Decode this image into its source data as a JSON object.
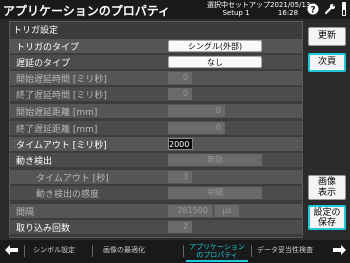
{
  "window": {
    "title": "アプリケーションのプロパティ",
    "setup_line1": "選択中セットアップ",
    "setup_line2": "Setup 1",
    "date": "2021/05/13",
    "time": "16:28"
  },
  "panel": {
    "title": "トリガ設定",
    "rows": {
      "trigger_type": {
        "label": "トリガのタイプ",
        "value": "シングル(外部)"
      },
      "delay_type": {
        "label": "遅延のタイプ",
        "value": "なし"
      },
      "start_delay_time": {
        "label": "開始遅延時間 [ミリ秒]",
        "value": "0"
      },
      "end_delay_time": {
        "label": "終了遅延時間 [ミリ秒]",
        "value": "0"
      },
      "start_delay_distance": {
        "label": "開始遅延距離 [mm]",
        "value": "0"
      },
      "end_delay_distance": {
        "label": "終了遅延距離 [mm]",
        "value": "0"
      },
      "timeout": {
        "label": "タイムアウト [ミリ秒]",
        "value": "2000"
      },
      "motion_detection": {
        "label": "動き検出",
        "value": "無効"
      },
      "motion_timeout": {
        "label": "タイムアウト [秒]",
        "value": "3"
      },
      "motion_sensitivity": {
        "label": "動き検出の感度",
        "value": "中間"
      },
      "interval": {
        "label": "間隔",
        "value": "281500",
        "unit": "μs"
      },
      "capture_count": {
        "label": "取り込み回数",
        "value": "2"
      }
    }
  },
  "side_buttons": {
    "update": "更新",
    "next": "次頁",
    "image_display_l1": "画像",
    "image_display_l2": "表示",
    "save_settings_l1": "設定の",
    "save_settings_l2": "保存"
  },
  "bottom_nav": {
    "tab1": "シンボル設定",
    "tab2": "画像の最適化",
    "tab3_l1": "アプリケーション",
    "tab3_l2": "のプロパティ",
    "tab4": "データ妥当性検査"
  },
  "colors": {
    "accent": "#1ec8d8",
    "background": "#2b2b2b",
    "panel": "#3c3c3c"
  },
  "icons": [
    "question-icon",
    "wrench-icon",
    "status-icon",
    "back-arrow-icon",
    "forward-arrow-icon"
  ]
}
